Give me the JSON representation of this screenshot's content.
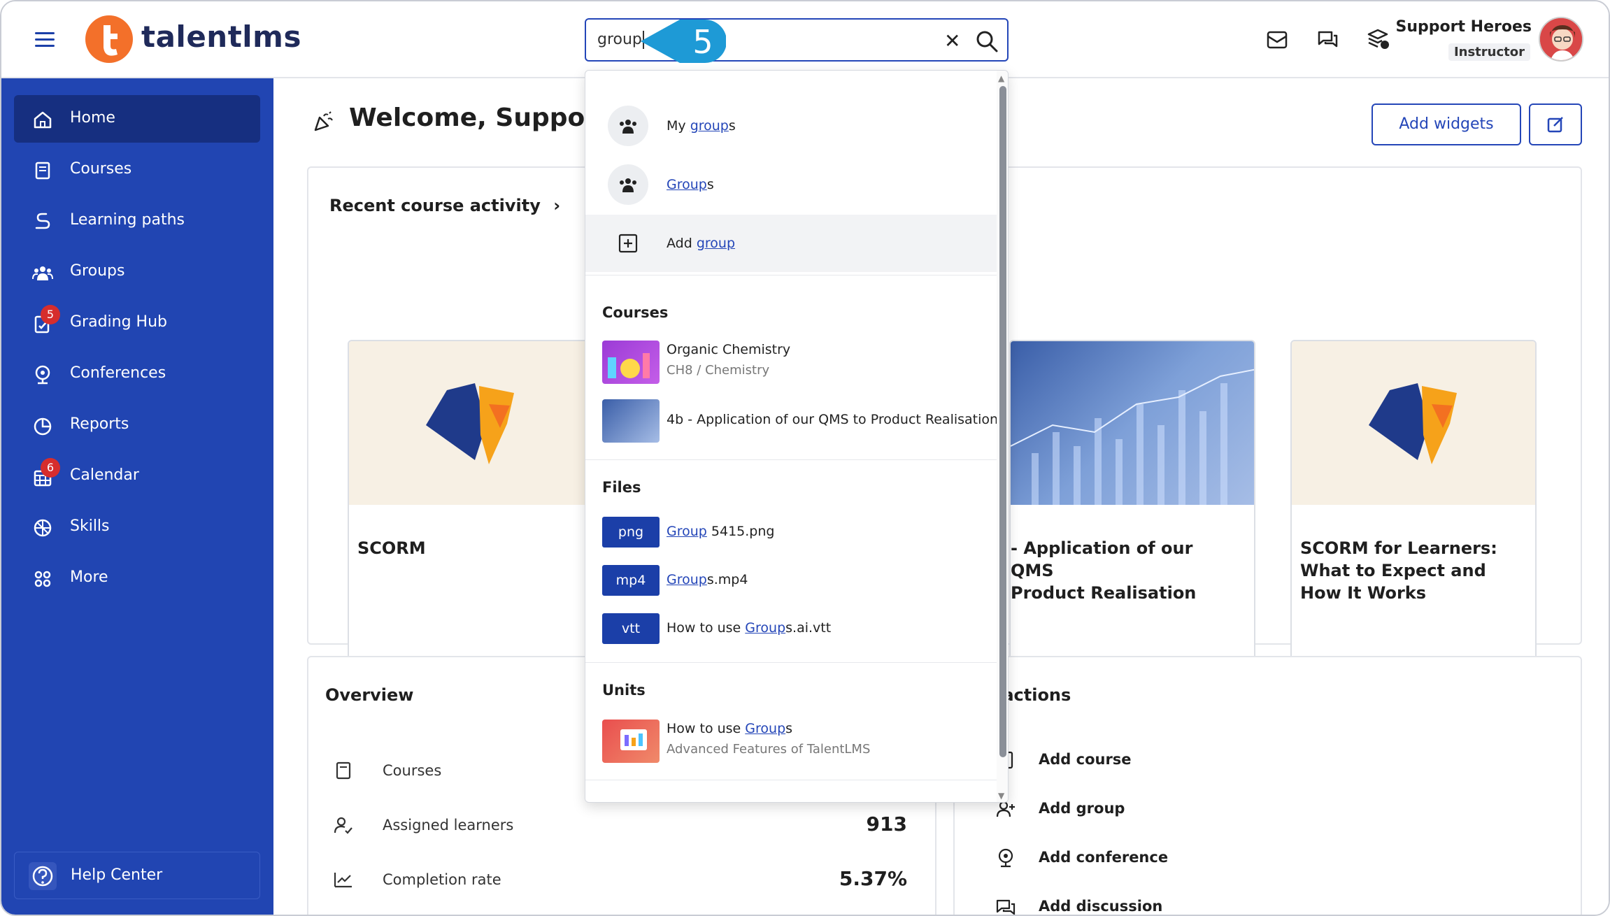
{
  "header": {
    "logo_text": "talentlms",
    "search_value": "group",
    "step_number": "5",
    "user_name": "Support Heroes",
    "user_role": "Instructor",
    "icons": [
      "messages-icon",
      "chat-icon",
      "switch-role-icon"
    ]
  },
  "sidebar": {
    "items": [
      {
        "label": "Home",
        "icon": "home-icon",
        "active": true
      },
      {
        "label": "Courses",
        "icon": "book-icon"
      },
      {
        "label": "Learning paths",
        "icon": "path-icon"
      },
      {
        "label": "Groups",
        "icon": "groups-icon"
      },
      {
        "label": "Grading Hub",
        "icon": "grading-icon",
        "badge": "5"
      },
      {
        "label": "Conferences",
        "icon": "webcam-icon"
      },
      {
        "label": "Reports",
        "icon": "pie-chart-icon"
      },
      {
        "label": "Calendar",
        "icon": "calendar-icon",
        "badge": "6"
      },
      {
        "label": "Skills",
        "icon": "skills-icon"
      },
      {
        "label": "More",
        "icon": "grid-icon"
      }
    ],
    "help_label": "Help Center"
  },
  "main": {
    "welcome": "Welcome, Support!",
    "add_widgets": "Add widgets",
    "recent_title": "Recent course activity",
    "cards": [
      {
        "title": "SCORM"
      },
      {
        "title": "- Application of our QMS\nProduct Realisation"
      },
      {
        "title": "SCORM for Learners: What to Expect and How It Works"
      }
    ],
    "overview_title": "Overview",
    "overview_rows": [
      {
        "label": "Courses",
        "value": ""
      },
      {
        "label": "Assigned learners",
        "value": "913"
      },
      {
        "label": "Completion rate",
        "value": "5.37%"
      }
    ],
    "quick_title": "k actions",
    "quick_rows": [
      {
        "label": "Add course"
      },
      {
        "label": "Add group"
      },
      {
        "label": "Add conference"
      },
      {
        "label": "Add discussion"
      }
    ]
  },
  "dropdown": {
    "actions": [
      {
        "prefix": "My ",
        "match": "group",
        "suffix": "s"
      },
      {
        "prefix": "",
        "match": "Group",
        "suffix": "s"
      },
      {
        "prefix": "Add ",
        "match": "group",
        "suffix": ""
      }
    ],
    "courses_head": "Courses",
    "courses": [
      {
        "title": "Organic Chemistry",
        "sub": "CH8 / Chemistry"
      },
      {
        "title": "4b - Application of our QMS to Product Realisation",
        "sub": ""
      }
    ],
    "files_head": "Files",
    "files": [
      {
        "ext": "png",
        "prefix": "",
        "match": "Group",
        "suffix": " 5415.png"
      },
      {
        "ext": "mp4",
        "prefix": "",
        "match": "Group",
        "suffix": "s.mp4"
      },
      {
        "ext": "vtt",
        "prefix": "How to use ",
        "match": "Group",
        "suffix": "s.ai.vtt"
      }
    ],
    "units_head": "Units",
    "units": [
      {
        "prefix": "How to use ",
        "match": "Group",
        "suffix": "s",
        "sub": "Advanced Features of TalentLMS"
      }
    ]
  },
  "colors": {
    "primary": "#2145b2",
    "accent": "#f3702a",
    "callout": "#1e9ad6"
  }
}
